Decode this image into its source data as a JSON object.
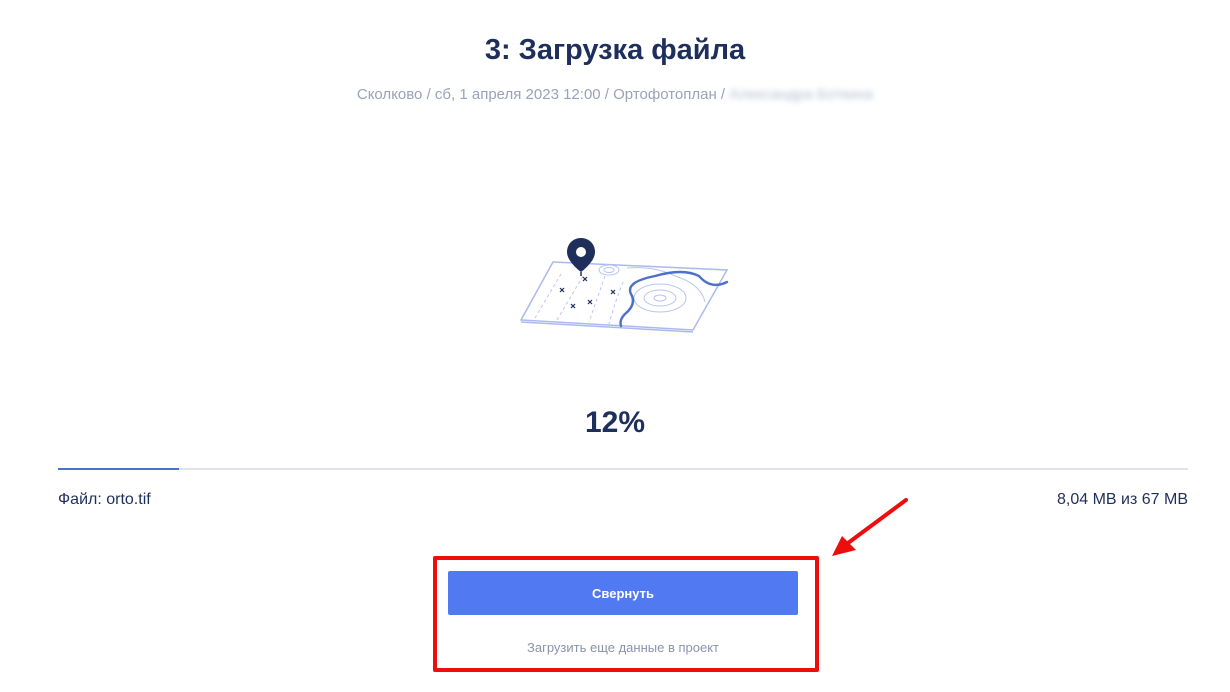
{
  "header": {
    "title": "3: Загрузка файла",
    "breadcrumb": {
      "location": "Сколково",
      "separator": " / ",
      "date": "сб, 1 апреля 2023 12:00",
      "product": "Ортофотоплан",
      "user_blurred": "Александра Боткина"
    }
  },
  "progress": {
    "percent_label": "12%",
    "fraction": 0.107
  },
  "file": {
    "label": "Файл: orto.tif",
    "size_label": "8,04 MB из 67 MB"
  },
  "actions": {
    "collapse_label": "Свернуть",
    "upload_more_label": "Загрузить еще данные в проект"
  },
  "colors": {
    "title": "#1f2f5c",
    "accent": "#5079f2",
    "progress_fill": "#4d70c8",
    "annotation": "#ee0d0d"
  },
  "icons": {
    "illustration": "map-pin-illustration",
    "annotation_arrow": "red-arrow-icon"
  }
}
